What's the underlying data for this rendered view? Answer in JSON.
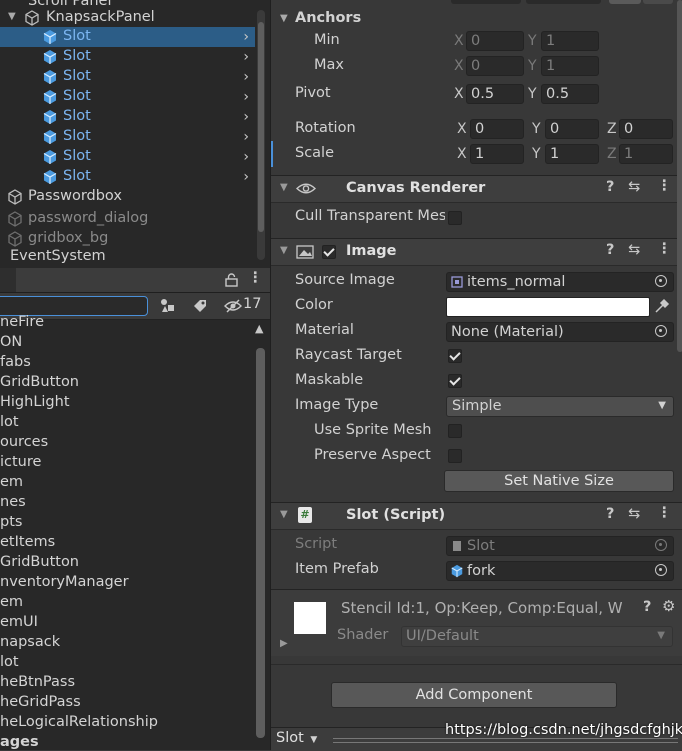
{
  "hierarchy": {
    "items": [
      {
        "label": "Scroll Panel"
      },
      {
        "label": "KnapsackPanel"
      },
      {
        "label": "Slot"
      },
      {
        "label": "Slot"
      },
      {
        "label": "Slot"
      },
      {
        "label": "Slot"
      },
      {
        "label": "Slot"
      },
      {
        "label": "Slot"
      },
      {
        "label": "Slot"
      },
      {
        "label": "Slot"
      },
      {
        "label": "Passwordbox"
      },
      {
        "label": "password_dialog"
      },
      {
        "label": "gridbox_bg"
      },
      {
        "label": "EventSystem"
      }
    ]
  },
  "project": {
    "hidden_count": "17",
    "items": [
      "neFire",
      "ON",
      "fabs",
      "GridButton",
      "HighLight",
      "lot",
      "ources",
      "icture",
      "em",
      "nes",
      "pts",
      "etItems",
      "GridButton",
      "nventoryManager",
      "em",
      "emUI",
      "napsack",
      "lot",
      "heBtnPass",
      "heGridPass",
      "heLogicalRelationship",
      "ages"
    ]
  },
  "inspector": {
    "anchors": {
      "label": "Anchors",
      "min_label": "Min",
      "max_label": "Max",
      "min_x": "0",
      "min_y": "1",
      "max_x": "0",
      "max_y": "1"
    },
    "pivot": {
      "label": "Pivot",
      "x": "0.5",
      "y": "0.5"
    },
    "rotation": {
      "label": "Rotation",
      "x": "0",
      "y": "0",
      "z": "0"
    },
    "scale": {
      "label": "Scale",
      "x": "1",
      "y": "1",
      "z": "1"
    },
    "axes": {
      "x": "X",
      "y": "Y",
      "z": "Z"
    },
    "canvas_renderer": {
      "title": "Canvas Renderer",
      "cull_label": "Cull Transparent Mes"
    },
    "image": {
      "title": "Image",
      "source_image_label": "Source Image",
      "source_image_value": "items_normal",
      "color_label": "Color",
      "material_label": "Material",
      "material_value": "None (Material)",
      "raycast_label": "Raycast Target",
      "maskable_label": "Maskable",
      "image_type_label": "Image Type",
      "image_type_value": "Simple",
      "sprite_mesh_label": "Use Sprite Mesh",
      "preserve_label": "Preserve Aspect",
      "native_size_button": "Set Native Size"
    },
    "slot_script": {
      "title": "Slot (Script)",
      "script_label": "Script",
      "script_value": "Slot",
      "prefab_label": "Item Prefab",
      "prefab_value": "fork"
    },
    "material_preview": {
      "stencil": "Stencil Id:1, Op:Keep, Comp:Equal, W",
      "shader_label": "Shader",
      "shader_value": "UI/Default"
    },
    "add_component": "Add Component",
    "footer": {
      "object": "Slot",
      "watermark": "https://blog.csdn.net/jhgsdcfghjkl"
    }
  },
  "colors": {
    "selection": "#2c5d87",
    "prefab_blue": "#7cb6f2",
    "panel": "#383838",
    "dark": "#282828"
  }
}
